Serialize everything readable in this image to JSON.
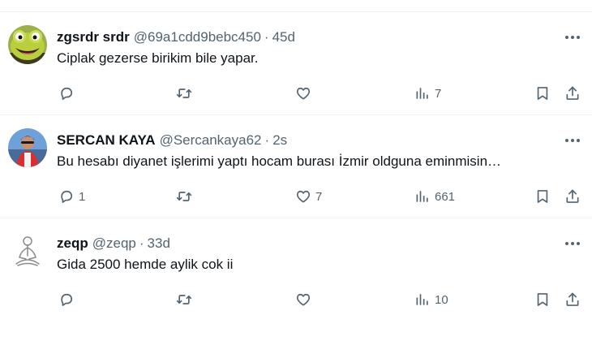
{
  "tweets": [
    {
      "name": "zgsrdr srdr",
      "handle": "@69a1cdd9bebc450",
      "separator": "·",
      "time": "45d",
      "text": "Ciplak gezerse birikim bile yapar.",
      "replies": "",
      "retweets": "",
      "likes": "",
      "views": "7",
      "avatar_icon": "green-frog-face-avatar"
    },
    {
      "name": "SERCAN KAYA",
      "handle": "@Sercankaya62",
      "separator": "·",
      "time": "2s",
      "text": "Bu hesabı diyanet işlerimi yaptı hocam burası İzmir oldguna eminmisin…",
      "replies": "1",
      "retweets": "",
      "likes": "7",
      "views": "661",
      "avatar_icon": "person-photo-avatar"
    },
    {
      "name": "zeqp",
      "handle": "@zeqp",
      "separator": "·",
      "time": "33d",
      "text": "Gida 2500 hemde aylik cok ii",
      "replies": "",
      "retweets": "",
      "likes": "",
      "views": "10",
      "avatar_icon": "meditating-figure-avatar"
    }
  ],
  "colors": {
    "text_primary": "#0f1419",
    "text_secondary": "#536471",
    "divider": "#eff3f4"
  }
}
